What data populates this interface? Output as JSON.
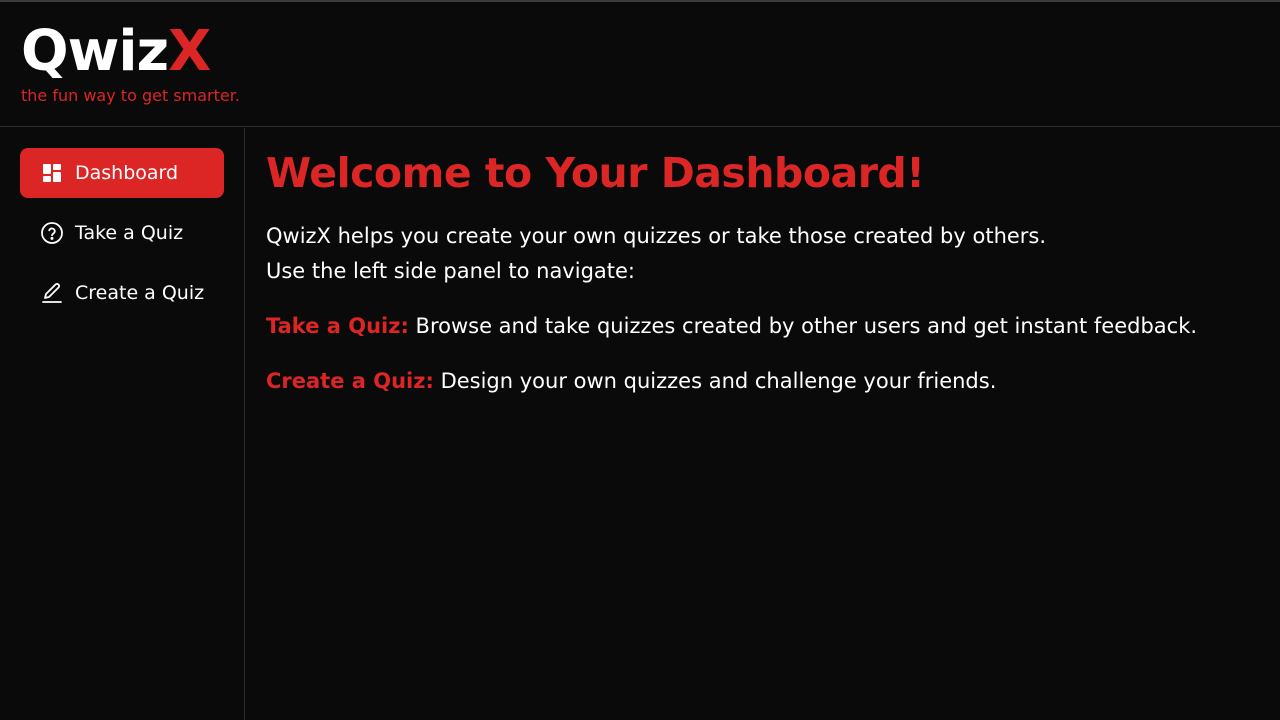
{
  "header": {
    "logo_main": "Qwiz",
    "logo_accent": "X",
    "tagline": "the fun way to get smarter."
  },
  "sidebar": {
    "items": [
      {
        "label": "Dashboard",
        "icon": "dashboard-icon",
        "active": true
      },
      {
        "label": "Take a Quiz",
        "icon": "question-circle-icon",
        "active": false
      },
      {
        "label": "Create a Quiz",
        "icon": "pencil-icon",
        "active": false
      }
    ]
  },
  "main": {
    "title": "Welcome to Your Dashboard!",
    "intro_line1": "QwizX helps you create your own quizzes or take those created by others.",
    "intro_line2": "Use the left side panel to navigate:",
    "features": [
      {
        "term": "Take a Quiz:",
        "description": " Browse and take quizzes created by other users and get instant feedback."
      },
      {
        "term": "Create a Quiz:",
        "description": " Design your own quizzes and challenge your friends."
      }
    ]
  },
  "colors": {
    "accent": "#dc2626",
    "background": "#0a0a0b",
    "text": "#ffffff"
  }
}
